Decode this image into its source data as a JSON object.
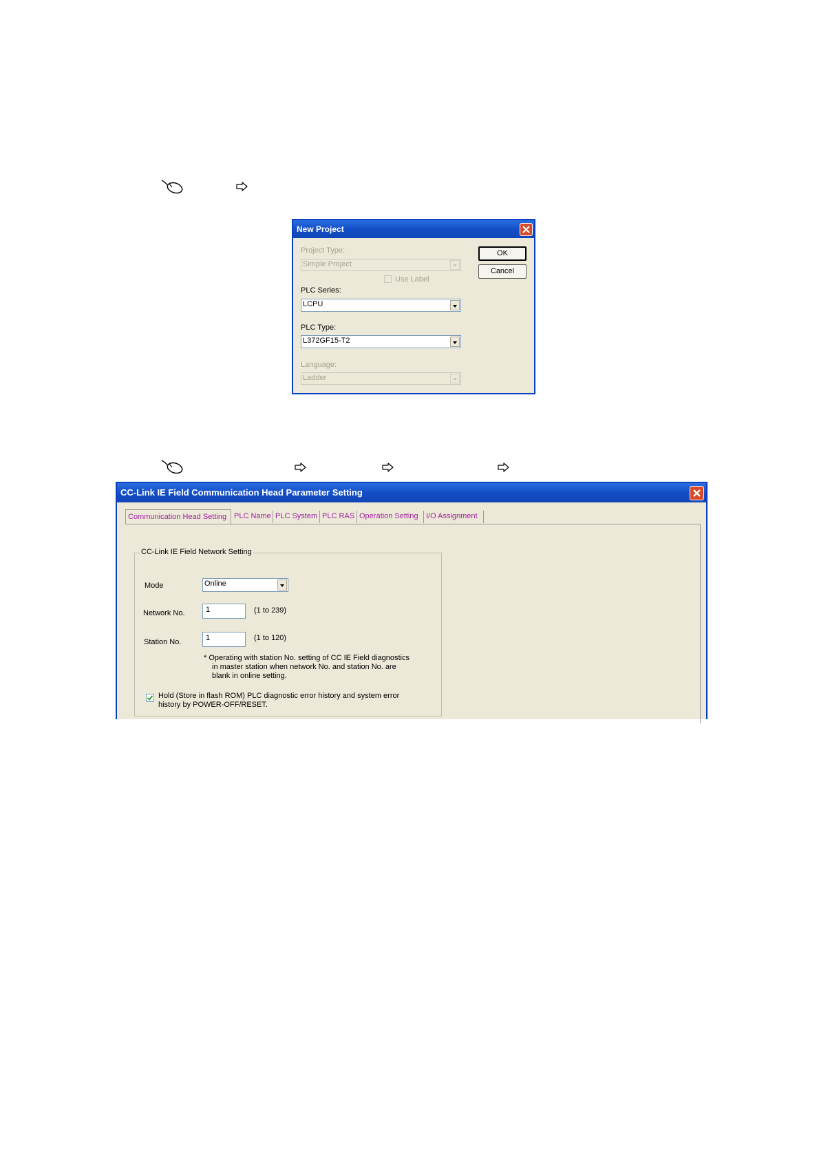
{
  "new_project": {
    "title": "New Project",
    "project_type_label": "Project Type:",
    "project_type_value": "Simple Project",
    "use_label": "Use Label",
    "plc_series_label": "PLC Series:",
    "plc_series_value": "LCPU",
    "plc_type_label": "PLC Type:",
    "plc_type_value": "L372GF15-T2",
    "language_label": "Language:",
    "language_value": "Ladder",
    "ok_label": "OK",
    "cancel_label": "Cancel"
  },
  "cc_link": {
    "title": "CC-Link IE Field Communication Head Parameter Setting",
    "tabs": [
      {
        "label": "Communication Head Setting"
      },
      {
        "label": "PLC Name"
      },
      {
        "label": "PLC System"
      },
      {
        "label": "PLC RAS"
      },
      {
        "label": "Operation Setting"
      },
      {
        "label": "I/O Assignment"
      }
    ],
    "group_title": "CC-Link IE Field Network Setting",
    "mode_label": "Mode",
    "mode_value": "Online",
    "network_label": "Network No.",
    "network_value": "1",
    "network_range": "(1 to 239)",
    "station_label": "Station No.",
    "station_value": "1",
    "station_range": "(1 to 120)",
    "note_line1": "* Operating with station No. setting of CC IE Field diagnostics",
    "note_line2": "in master station when network No. and station No. are",
    "note_line3": "blank in online setting.",
    "hold_line1": "Hold (Store in flash ROM) PLC diagnostic error history and system error",
    "hold_line2": "history by POWER-OFF/RESET."
  },
  "icons": [
    "mouse-icon",
    "right-arrow-icon",
    "close-icon",
    "chevron-down-icon",
    "checkmark-icon"
  ]
}
